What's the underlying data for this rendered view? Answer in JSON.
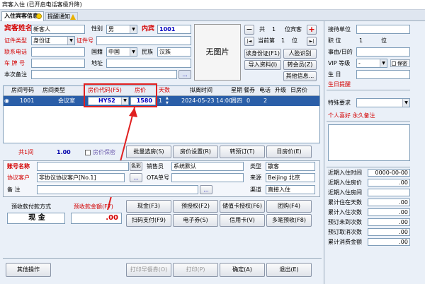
{
  "window": {
    "title": "宾客入住 (已开启电话客级升降)"
  },
  "tabs": [
    {
      "label": "入住宾客信息"
    },
    {
      "label": "提醒通知"
    }
  ],
  "guest": {
    "name_label": "宾客姓名",
    "name_value": "新客人",
    "gender_label": "性别",
    "gender_value": "男",
    "room_label": "内宾",
    "room_no": "1001",
    "id_type_label": "证件类型",
    "id_type_value": "身份证",
    "id_no_label": "证件号",
    "phone_label": "联系电话",
    "nation_label": "国籍",
    "nation_value": "中国",
    "ethnic_label": "民族",
    "ethnic_value": "汉族",
    "plate_label": "车 牌 号",
    "address_label": "地址",
    "remark_label": "本次备注",
    "remark_btn": "..."
  },
  "photo": {
    "label": "无图片"
  },
  "nav": {
    "minus": "−",
    "count_label": "共",
    "count_value": "1",
    "unit_label": "位宾客",
    "plus": "+",
    "first": "|◄",
    "current_label": "当前第",
    "current_value": "1",
    "pos_unit": "位",
    "last": "►|"
  },
  "actions": {
    "read_id": "读身份证(F1)",
    "face": "人脸识别",
    "import": "导入资料(I)",
    "to_member": "转会员(Z)",
    "other_info": "其他信息..."
  },
  "right_panel": {
    "unit_label": "接待单位",
    "position_label": "职 位",
    "position_value": "1",
    "position_unit": "位",
    "month_day_label": "事由/日的",
    "vip_label": "VIP 等级",
    "vip_value": "-",
    "secret_label": "保密",
    "birthday_label": "生 日",
    "birthday_hint": "生日提醒",
    "special_label": "特殊要求",
    "hobby_label": "个人喜好 永久备注",
    "stats": [
      {
        "label": "近期入住时间",
        "value": "0000-00-00"
      },
      {
        "label": "近期入住房价",
        "value": ".00"
      },
      {
        "label": "近期入住房间",
        "value": ""
      },
      {
        "label": "累计住在天数",
        "value": ".00"
      },
      {
        "label": "累计入住次数",
        "value": ".00"
      },
      {
        "label": "预订未到次数",
        "value": ".00"
      },
      {
        "label": "预订取消次数",
        "value": ".00"
      },
      {
        "label": "累计消费金额",
        "value": ".00"
      }
    ]
  },
  "room_table": {
    "headers": [
      "房间号码",
      "房间类型",
      "房价代码(F5)",
      "房价",
      "天数",
      "拟离时间",
      "星期",
      "餐券",
      "电话",
      "升级",
      "日房价"
    ],
    "rows": [
      {
        "marker": "◉",
        "room_no": "1001",
        "room_type": "会议室",
        "rate_code": "HYS2",
        "price": "1580",
        "days": "1",
        "depart": "2024-05-23 14:00",
        "weekday": "周四",
        "meal": "0",
        "phone": "2",
        "upgrade": "",
        "day_rate": ""
      }
    ]
  },
  "summary": {
    "count_label": "共1间",
    "amount": "1.00",
    "secret_label": "房价保密"
  },
  "room_buttons": {
    "batch": "批量选房(S)",
    "price_set": "房价设置(R)",
    "to_booking": "转预订(T)",
    "day_rate": "日房价(E)"
  },
  "account": {
    "account_label": "账号名称",
    "agreement_label": "协议客户",
    "agreement_value": "非协议协议客户[No.1]",
    "color_btn": "色彩",
    "find_btn": "...",
    "sales_label": "销售员",
    "sales_value": "系统默认",
    "type_label": "类型",
    "type_value": "散客",
    "ota_label": "OTA单号",
    "source_label": "来源",
    "source_value": "Beijing 北京",
    "remark_label": "备 注",
    "channel_label": "渠道",
    "channel_value": "直接入住"
  },
  "deposit": {
    "method_label": "预收款付款方式",
    "method_value": "现 金",
    "amount_label": "预收款金额(F7)",
    "amount_value": ".00"
  },
  "pay_buttons": {
    "cash": "现金(F3)",
    "pre_auth": "预授权(F2)",
    "stored_auth": "储值卡授权(F6)",
    "group": "团购(F4)",
    "scan": "扫码支付(F9)",
    "e_coupon": "电子券(S)",
    "credit": "信用卡(V)",
    "multi": "多笔预收(F8)"
  },
  "footer": {
    "other_ops": "其他操作",
    "print_breakfast": "打印早餐券(O)",
    "print": "打印(P)",
    "confirm": "确定(A)",
    "exit": "退出(E)"
  }
}
